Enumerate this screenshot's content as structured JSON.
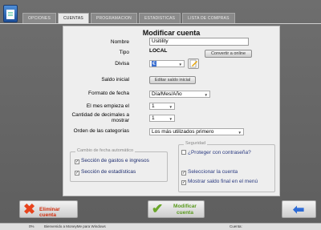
{
  "tabs": [
    {
      "label": "Opciones",
      "active": false
    },
    {
      "label": "Cuentas",
      "active": true
    },
    {
      "label": "Programacion",
      "active": false
    },
    {
      "label": "Estadisticas",
      "active": false
    },
    {
      "label": "Lista de compras",
      "active": false
    }
  ],
  "panel": {
    "title": "Modificar cuenta",
    "name_label": "Nombre",
    "name_value": "Usitility",
    "type_label": "Tipo",
    "type_value": "LOCAL",
    "convert_button": "Convertir a online",
    "currency_label": "Divisa",
    "currency_value": "€",
    "initial_balance_label": "Saldo inicial",
    "edit_balance_button": "Editar saldo inicial",
    "date_format_label": "Formato de fecha",
    "date_format_value": "Día/Mes/Año",
    "month_start_label": "El mes empieza el",
    "month_start_value": "1",
    "decimals_label": "Cantidad de decimales a mostrar",
    "decimals_value": "1",
    "category_order_label": "Orden de las categorías",
    "category_order_value": "Los más utilizados primero"
  },
  "auto_date_group": {
    "title": "Cambio de fecha automático",
    "items": [
      {
        "label": "Sección de gastos e ingresos",
        "checked": true
      },
      {
        "label": "Sección de estadísticas",
        "checked": true
      }
    ]
  },
  "security_group": {
    "title": "Seguridad",
    "items": [
      {
        "label": "¿Proteger con contraseña?",
        "checked": false
      },
      {
        "label": "Seleccionar la cuenta",
        "checked": true
      },
      {
        "label": "Mostrar saldo final en el menú",
        "checked": true
      }
    ]
  },
  "footer": {
    "delete_label": "Eliminar cuenta",
    "modify_label": "Modificar cuenta"
  },
  "status_bar": {
    "progress": "0%",
    "message": "Bienvenido a MoneyMe para Windows",
    "account_label": "Cuenta:"
  }
}
